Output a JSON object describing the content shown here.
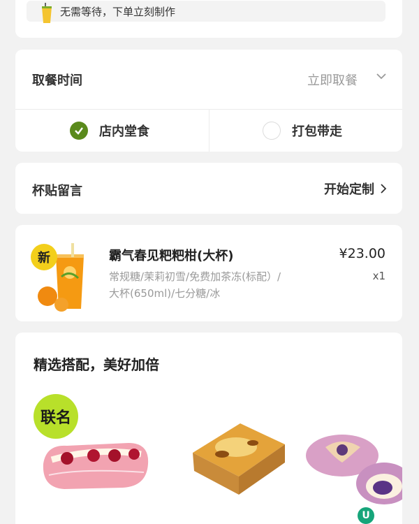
{
  "notice": {
    "text": "无需等待，下单立刻制作",
    "icon": "milk-tea-cup-icon"
  },
  "pickup": {
    "title": "取餐时间",
    "value": "立即取餐",
    "options": [
      {
        "label": "店内堂食",
        "selected": true
      },
      {
        "label": "打包带走",
        "selected": false
      }
    ]
  },
  "sticker": {
    "title": "杯贴留言",
    "action": "开始定制"
  },
  "cart_item": {
    "badge": "新",
    "name": "霸气春见粑粑柑(大杯)",
    "price": "¥23.00",
    "specs_line1": "常规糖/茉莉初雪/免费加茶冻(标配）/",
    "specs_line2": "大杯(650ml)/七分糖/冰",
    "quantity": "x1"
  },
  "combo": {
    "title": "精选搭配，美好加倍",
    "badge": "联名",
    "items": [
      {
        "icon": "strawberry-cream-bread-icon"
      },
      {
        "icon": "brulee-toast-icon"
      },
      {
        "icon": "purple-yam-bun-icon"
      }
    ]
  },
  "colors": {
    "accent_green": "#5a8a1c",
    "badge_yellow": "#f3cf1b",
    "badge_lime": "#b8e02a"
  }
}
